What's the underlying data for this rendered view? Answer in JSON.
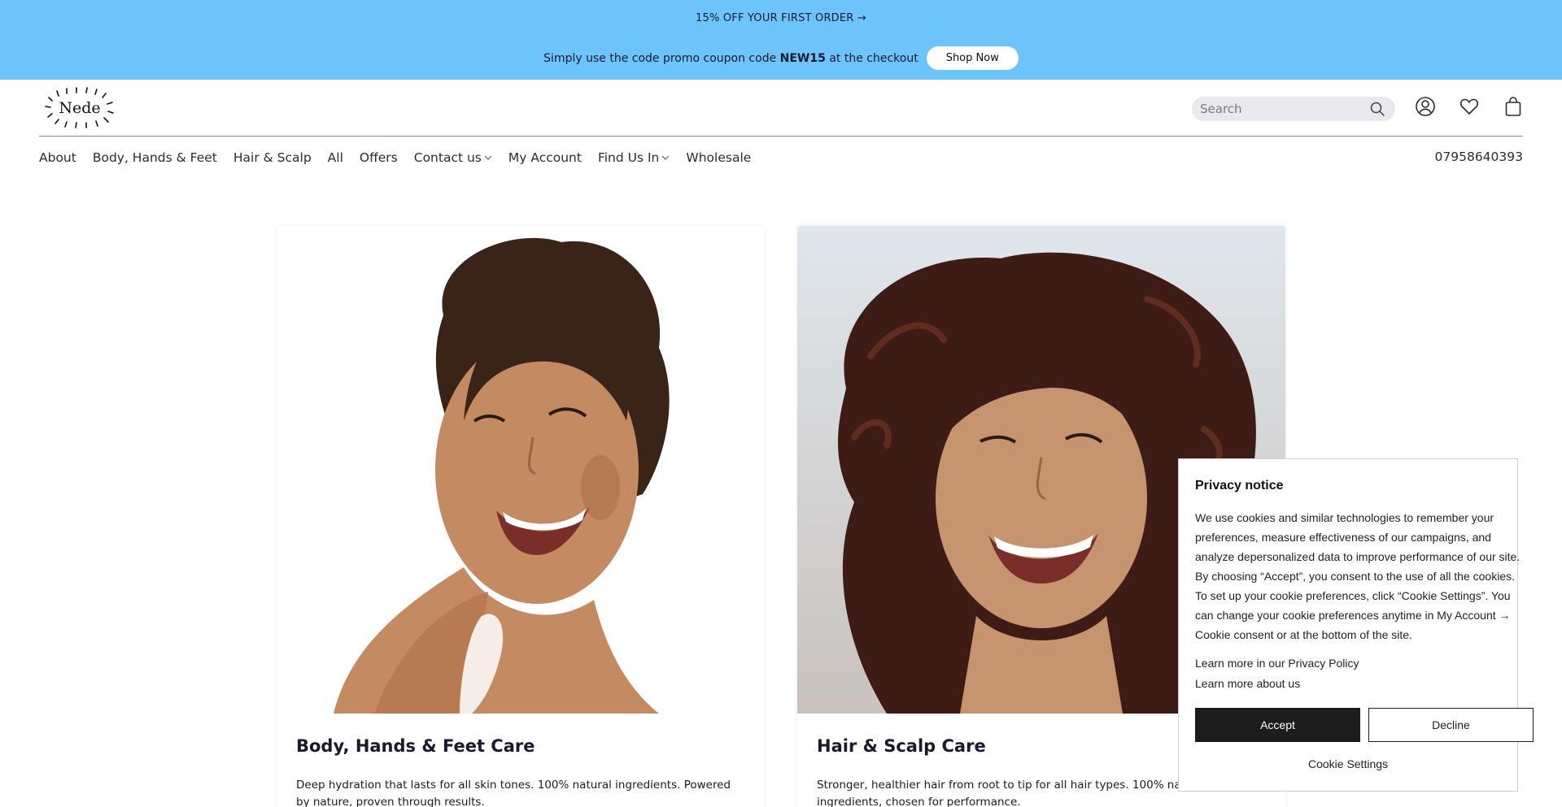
{
  "announcement": {
    "top_text": "15% OFF YOUR FIRST ORDER →",
    "promo_prefix": "Simply use the code promo coupon code ",
    "promo_code": "NEW15",
    "promo_suffix": " at the checkout",
    "shop_button": "Shop Now",
    "background_color": "#6cc4fb"
  },
  "header": {
    "logo_text": "Nede",
    "search_placeholder": "Search",
    "icons": [
      "account-icon",
      "wishlist-heart-icon",
      "shopping-bag-icon"
    ]
  },
  "nav": {
    "items": [
      {
        "label": "About",
        "dropdown": false
      },
      {
        "label": "Body, Hands & Feet",
        "dropdown": false
      },
      {
        "label": "Hair & Scalp",
        "dropdown": false
      },
      {
        "label": "All",
        "dropdown": false
      },
      {
        "label": "Offers",
        "dropdown": false
      },
      {
        "label": "Contact us",
        "dropdown": true
      },
      {
        "label": "My Account",
        "dropdown": false
      },
      {
        "label": "Find Us In",
        "dropdown": true
      },
      {
        "label": "Wholesale",
        "dropdown": false
      }
    ],
    "phone": "07958640393"
  },
  "cards": [
    {
      "title": "Body, Hands & Feet Care",
      "description": "Deep hydration that lasts for all skin tones. 100% natural ingredients. Powered by nature, proven through results."
    },
    {
      "title": "Hair & Scalp Care",
      "description": "Stronger, healthier hair from root to tip for all hair types. 100% natural ingredients, chosen for performance."
    }
  ],
  "privacy": {
    "title": "Privacy notice",
    "body": "We use cookies and similar technologies to remember your preferences, measure effectiveness of our campaigns, and analyze depersonalized data to improve performance of our site. By choosing “Accept”, you consent to the use of all the cookies. To set up your cookie preferences, click “Cookie Settings”. You can change your cookie preferences anytime in My Account → Cookie consent or at the bottom of the site.",
    "link_policy": "Learn more in our Privacy Policy",
    "link_about": "Learn more about us",
    "accept": "Accept",
    "decline": "Decline",
    "settings": "Cookie Settings"
  }
}
